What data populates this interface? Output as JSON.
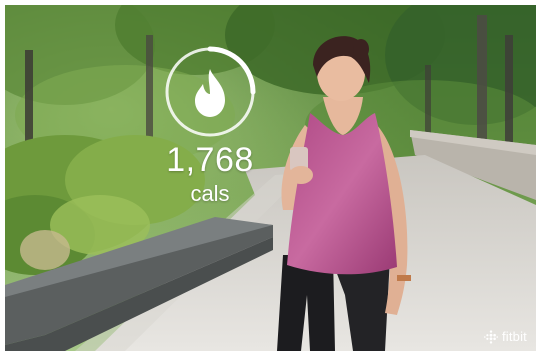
{
  "calories": {
    "value": "1,768",
    "unit": "cals",
    "icon": "flame-icon",
    "ring_color": "#ffffff"
  },
  "brand": {
    "name": "fitbit",
    "icon": "fitbit-dots-icon"
  },
  "photo": {
    "icon": "photo-background"
  }
}
